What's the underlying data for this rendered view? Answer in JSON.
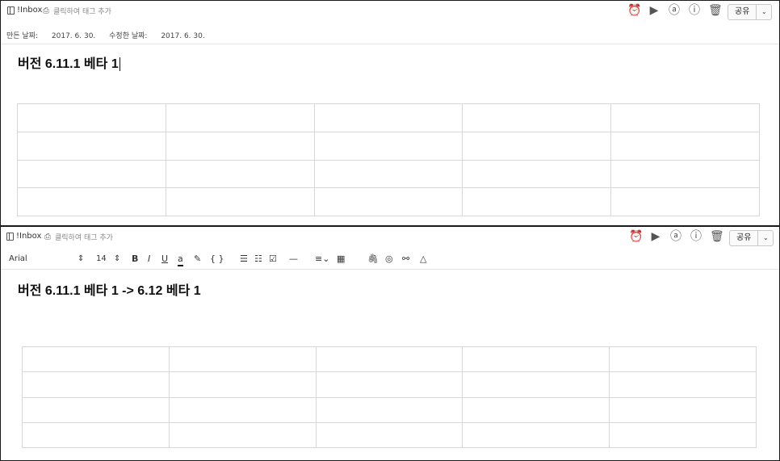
{
  "top": {
    "notebook": "!Inbox",
    "tag_placeholder": "클릭하여 태그 추가",
    "created_label": "만든 날짜:",
    "created_date": "2017. 6. 30.",
    "modified_label": "수정한 날짜:",
    "modified_date": "2017. 6. 30.",
    "title": "버전 6.11.1 베타 1",
    "share_label": "공유"
  },
  "bottom": {
    "notebook": "!Inbox",
    "tag_placeholder": "클릭하여 태그 추가",
    "font_name": "Arial",
    "font_size": "14",
    "title": "버전 6.11.1 베타 1 -> 6.12 베타 1",
    "share_label": "공유"
  },
  "icons": {
    "alarm": "⏰",
    "presentation": "▶",
    "at": "ⓐ",
    "info": "ⓘ",
    "trash": "🗑",
    "tag": "⎙",
    "dropdown": "⌄"
  },
  "toolbar": {
    "bold": "B",
    "italic": "I",
    "underline": "U",
    "font_color": "a",
    "highlight": "✎",
    "code": "{ }",
    "bullets": "☰",
    "numbered": "☷",
    "checkbox": "☑",
    "hr": "—",
    "align": "≡⌄",
    "table": "▦",
    "attach": "🖇",
    "record": "◎",
    "link": "⚯",
    "drive": "△",
    "stepper": "⇕"
  },
  "table": {
    "rows": 4,
    "cols": 5
  }
}
